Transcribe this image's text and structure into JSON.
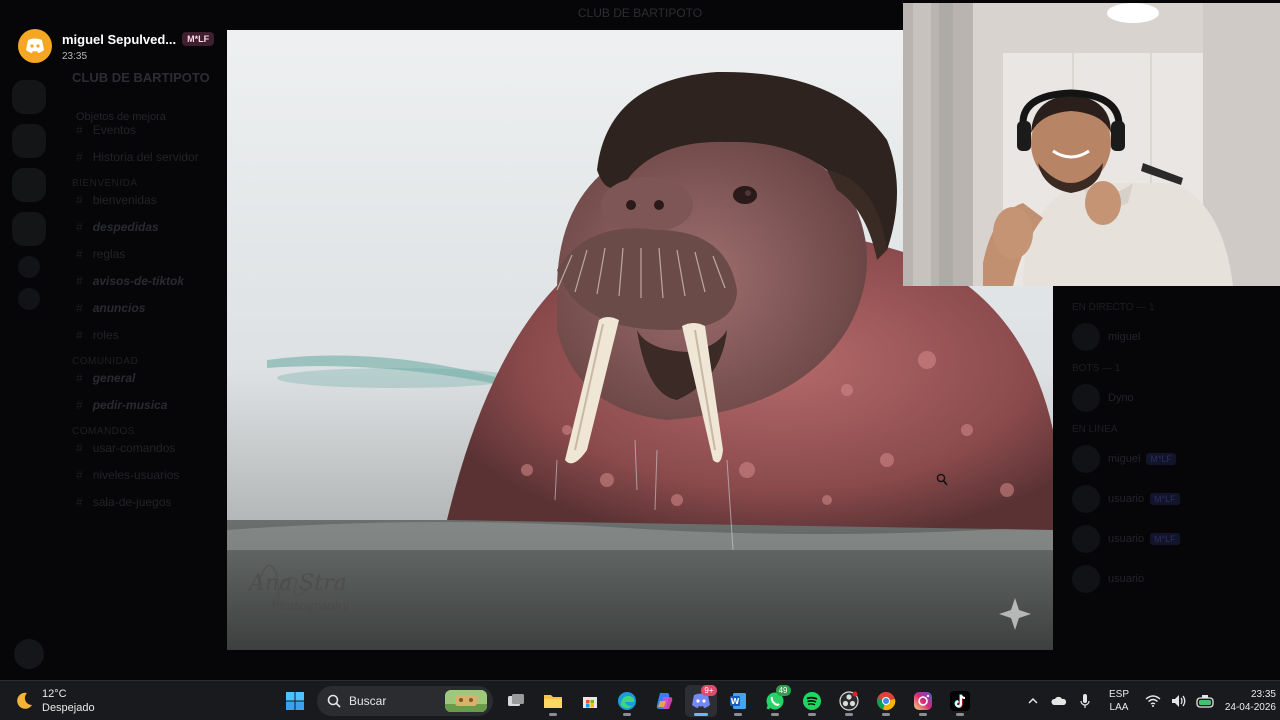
{
  "background": {
    "window_title": "CLUB DE BARTIPOTO",
    "server_name": "CLUB DE BARTIPOTO",
    "events_label": "Objetos de mejora",
    "channels": [
      {
        "cat": "",
        "items": [
          {
            "name": "Eventos",
            "bold": false
          },
          {
            "name": "Historia del servidor",
            "bold": false
          }
        ]
      },
      {
        "cat": "BIENVENIDA",
        "items": [
          {
            "name": "bienvenidas",
            "bold": false
          },
          {
            "name": "despedidas",
            "bold": true
          },
          {
            "name": "reglas",
            "bold": false
          },
          {
            "name": "avisos-de-tiktok",
            "bold": true
          },
          {
            "name": "anuncios",
            "bold": true
          },
          {
            "name": "roles",
            "bold": false
          }
        ]
      },
      {
        "cat": "COMUNIDAD",
        "items": [
          {
            "name": "general",
            "bold": true
          },
          {
            "name": "pedir-musica",
            "bold": true
          }
        ]
      },
      {
        "cat": "COMANDOS",
        "items": [
          {
            "name": "usar-comandos",
            "bold": false
          },
          {
            "name": "niveles-usuarios",
            "bold": false
          },
          {
            "name": "sala-de-juegos",
            "bold": false
          }
        ]
      }
    ],
    "members": [
      {
        "cat": "EN DIRECTO — 1",
        "items": [
          {
            "name": "miguel",
            "tag": ""
          }
        ]
      },
      {
        "cat": "BOTS — 1",
        "items": [
          {
            "name": "Dyno",
            "tag": ""
          }
        ]
      },
      {
        "cat": "EN LÍNEA",
        "items": [
          {
            "name": "miguel",
            "tag": "M*LF"
          },
          {
            "name": "usuario",
            "tag": "M*LF"
          },
          {
            "name": "usuario",
            "tag": "M*LF"
          },
          {
            "name": "usuario",
            "tag": ""
          }
        ]
      }
    ]
  },
  "notification": {
    "app_icon": "discord-icon",
    "user": "miguel Sepulved...",
    "badge": "M*LF",
    "time": "23:35"
  },
  "photo": {
    "subject": "walrus-photo",
    "watermark_sig": "Ana Stra",
    "watermark_text": "Photography"
  },
  "webcam": {
    "subject": "streamer-webcam"
  },
  "taskbar": {
    "weather_temp": "12°C",
    "weather_desc": "Despejado",
    "weather_icon": "moon-icon",
    "search_label": "Buscar",
    "apps": [
      {
        "name": "start",
        "icon": "windows-icon",
        "active": false,
        "count": ""
      },
      {
        "name": "task-view",
        "icon": "taskview-icon",
        "active": false,
        "count": ""
      },
      {
        "name": "file-explorer",
        "icon": "folder-icon",
        "active": false,
        "count": ""
      },
      {
        "name": "store",
        "icon": "store-icon",
        "active": false,
        "count": ""
      },
      {
        "name": "edge",
        "icon": "edge-icon",
        "active": false,
        "count": ""
      },
      {
        "name": "copilot",
        "icon": "copilot-icon",
        "active": false,
        "count": ""
      },
      {
        "name": "discord",
        "icon": "discord-icon",
        "active": true,
        "count": ""
      },
      {
        "name": "word",
        "icon": "word-icon",
        "active": false,
        "count": ""
      },
      {
        "name": "whatsapp",
        "icon": "whatsapp-icon",
        "active": false,
        "count": "49"
      },
      {
        "name": "spotify",
        "icon": "spotify-icon",
        "active": false,
        "count": ""
      },
      {
        "name": "obs",
        "icon": "obs-icon",
        "active": false,
        "count": ""
      },
      {
        "name": "chrome",
        "icon": "chrome-icon",
        "active": false,
        "count": ""
      },
      {
        "name": "instagram",
        "icon": "instagram-icon",
        "active": false,
        "count": ""
      },
      {
        "name": "tiktok",
        "icon": "tiktok-icon",
        "active": false,
        "count": ""
      }
    ],
    "lang_top": "ESP",
    "lang_bottom": "LAA",
    "time": "23:35",
    "date": "24-04-2026"
  }
}
